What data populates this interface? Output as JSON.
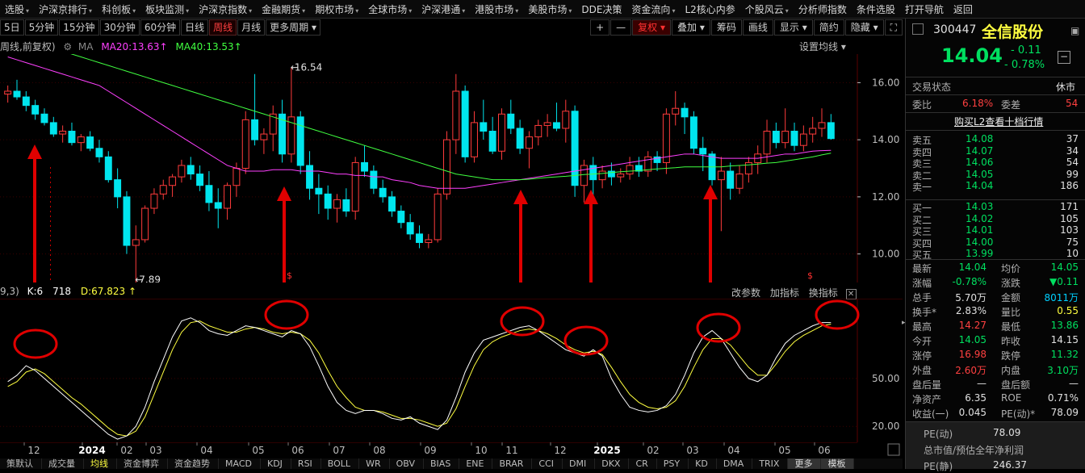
{
  "top_menu": [
    {
      "label": "选股",
      "dd": true
    },
    {
      "label": "沪深京排行",
      "dd": true
    },
    {
      "label": "科创板",
      "dd": true
    },
    {
      "label": "板块监测",
      "dd": true
    },
    {
      "label": "沪深京指数",
      "dd": true
    },
    {
      "label": "金融期货",
      "dd": true
    },
    {
      "label": "期权市场",
      "dd": true
    },
    {
      "label": "全球市场",
      "dd": true
    },
    {
      "label": "沪深港通",
      "dd": true
    },
    {
      "label": "港股市场",
      "dd": true
    },
    {
      "label": "美股市场",
      "dd": true
    },
    {
      "label": "DDE决策",
      "dd": false
    },
    {
      "label": "资金流向",
      "dd": true
    },
    {
      "label": "L2核心内参",
      "dd": false
    },
    {
      "label": "个股风云",
      "dd": true
    },
    {
      "label": "分析师指数",
      "dd": false
    },
    {
      "label": "条件选股",
      "dd": false
    },
    {
      "label": "打开导航",
      "dd": false
    },
    {
      "label": "返回",
      "dd": false
    }
  ],
  "toolbar": {
    "periods": [
      "5日",
      "5分钟",
      "15分钟",
      "30分钟",
      "60分钟",
      "日线",
      "周线",
      "月线",
      "更多周期 ▾"
    ],
    "active_period": "周线",
    "right_buttons": [
      "+",
      "—",
      "复权 ▾",
      "叠加 ▾",
      "筹码",
      "画线",
      "显示 ▾",
      "简约",
      "隐藏 ▾",
      "⛶"
    ]
  },
  "ma_legend": {
    "mode": "周线,前复权)",
    "ma_label": "MA",
    "ma20": "MA20:13.63",
    "ma40": "MA40:13.53",
    "settings": "设置均线 ▾"
  },
  "chart_data": {
    "type": "candlestick",
    "period": "weekly",
    "ylim": [
      9.0,
      17.0
    ],
    "y_ticks": [
      "16.00",
      "14.00",
      "12.00",
      "10.00"
    ],
    "x_labels": [
      "12",
      "2024",
      "02",
      "03",
      "04",
      "05",
      "06",
      "07",
      "08",
      "09",
      "10",
      "11",
      "12",
      "2025",
      "02",
      "03",
      "04",
      "05",
      "06"
    ],
    "candles": [
      [
        15.6,
        15.9,
        15.3,
        15.7
      ],
      [
        15.7,
        16.1,
        15.4,
        15.5
      ],
      [
        15.5,
        15.7,
        15.0,
        15.2
      ],
      [
        15.2,
        15.4,
        14.7,
        14.9
      ],
      [
        14.9,
        15.1,
        14.5,
        14.6
      ],
      [
        14.6,
        14.8,
        14.1,
        14.2
      ],
      [
        14.2,
        14.5,
        13.9,
        14.3
      ],
      [
        14.3,
        14.6,
        13.8,
        13.9
      ],
      [
        13.9,
        14.2,
        13.6,
        14.1
      ],
      [
        14.1,
        14.3,
        13.6,
        13.7
      ],
      [
        13.7,
        14.0,
        13.2,
        13.4
      ],
      [
        13.4,
        13.6,
        12.5,
        12.6
      ],
      [
        12.6,
        13.0,
        11.6,
        12.0
      ],
      [
        12.0,
        12.2,
        10.0,
        10.3
      ],
      [
        10.3,
        11.0,
        7.89,
        10.5
      ],
      [
        10.5,
        11.7,
        10.4,
        11.6
      ],
      [
        11.6,
        12.3,
        11.4,
        12.1
      ],
      [
        12.1,
        12.6,
        11.9,
        12.4
      ],
      [
        12.4,
        12.8,
        12.0,
        12.7
      ],
      [
        12.7,
        13.3,
        12.5,
        13.1
      ],
      [
        13.1,
        13.4,
        12.6,
        12.8
      ],
      [
        12.8,
        13.1,
        12.2,
        12.4
      ],
      [
        12.4,
        12.9,
        11.5,
        11.8
      ],
      [
        11.8,
        12.3,
        10.9,
        11.6
      ],
      [
        11.6,
        12.5,
        11.2,
        12.4
      ],
      [
        12.4,
        13.2,
        12.0,
        13.0
      ],
      [
        13.0,
        15.0,
        12.8,
        14.7
      ],
      [
        14.7,
        16.3,
        13.8,
        14.0
      ],
      [
        14.0,
        14.4,
        13.5,
        14.2
      ],
      [
        14.2,
        15.2,
        13.6,
        14.9
      ],
      [
        14.9,
        15.4,
        13.2,
        13.5
      ],
      [
        13.5,
        16.54,
        13.2,
        14.8
      ],
      [
        14.8,
        15.0,
        12.8,
        13.1
      ],
      [
        13.1,
        13.6,
        11.9,
        12.3
      ],
      [
        12.3,
        12.8,
        11.4,
        12.1
      ],
      [
        12.1,
        12.4,
        11.2,
        11.6
      ],
      [
        11.6,
        12.1,
        11.1,
        11.9
      ],
      [
        11.9,
        12.3,
        11.3,
        11.5
      ],
      [
        11.5,
        13.4,
        11.2,
        13.2
      ],
      [
        13.2,
        13.8,
        12.7,
        12.9
      ],
      [
        12.9,
        13.1,
        12.1,
        12.3
      ],
      [
        12.3,
        12.6,
        11.8,
        12.0
      ],
      [
        12.0,
        12.2,
        11.3,
        11.5
      ],
      [
        11.5,
        11.7,
        10.9,
        11.1
      ],
      [
        11.1,
        11.4,
        10.5,
        10.7
      ],
      [
        10.7,
        11.0,
        10.2,
        10.4
      ],
      [
        10.4,
        10.7,
        10.2,
        10.5
      ],
      [
        10.5,
        12.3,
        10.4,
        12.1
      ],
      [
        12.1,
        14.3,
        11.9,
        14.0
      ],
      [
        14.0,
        16.3,
        13.5,
        15.7
      ],
      [
        15.7,
        15.9,
        13.2,
        13.4
      ],
      [
        13.4,
        15.0,
        13.2,
        14.6
      ],
      [
        14.6,
        15.4,
        14.0,
        14.3
      ],
      [
        14.3,
        14.8,
        13.5,
        13.6
      ],
      [
        13.6,
        15.1,
        13.3,
        14.9
      ],
      [
        14.9,
        15.4,
        14.2,
        14.4
      ],
      [
        14.4,
        14.7,
        13.5,
        13.7
      ],
      [
        13.7,
        14.3,
        13.0,
        14.1
      ],
      [
        14.1,
        14.7,
        13.8,
        14.5
      ],
      [
        14.5,
        14.9,
        14.1,
        14.6
      ],
      [
        14.6,
        15.3,
        14.3,
        14.4
      ],
      [
        14.4,
        15.4,
        13.9,
        15.0
      ],
      [
        15.0,
        15.2,
        12.0,
        12.4
      ],
      [
        12.4,
        13.3,
        11.8,
        13.1
      ],
      [
        13.1,
        13.4,
        11.8,
        12.6
      ],
      [
        12.6,
        13.1,
        12.3,
        12.9
      ],
      [
        12.9,
        13.2,
        12.4,
        12.7
      ],
      [
        12.7,
        13.0,
        12.5,
        12.8
      ],
      [
        12.8,
        13.4,
        12.6,
        13.1
      ],
      [
        13.1,
        13.4,
        12.7,
        12.9
      ],
      [
        12.9,
        13.6,
        12.7,
        13.4
      ],
      [
        13.4,
        13.6,
        12.9,
        13.2
      ],
      [
        13.2,
        15.1,
        12.8,
        14.9
      ],
      [
        14.9,
        15.7,
        14.5,
        15.1
      ],
      [
        15.1,
        15.3,
        14.2,
        14.8
      ],
      [
        14.8,
        15.0,
        13.5,
        13.7
      ],
      [
        13.7,
        14.1,
        12.9,
        13.5
      ],
      [
        13.5,
        13.6,
        12.4,
        12.6
      ],
      [
        12.6,
        13.4,
        10.8,
        12.9
      ],
      [
        12.9,
        13.2,
        11.9,
        12.3
      ],
      [
        12.3,
        13.1,
        12.1,
        12.8
      ],
      [
        12.8,
        13.4,
        12.5,
        13.2
      ],
      [
        13.2,
        13.8,
        12.8,
        13.5
      ],
      [
        13.5,
        14.7,
        13.2,
        14.3
      ],
      [
        14.3,
        14.6,
        13.7,
        13.9
      ],
      [
        13.9,
        15.1,
        13.7,
        14.3
      ],
      [
        14.3,
        14.6,
        13.6,
        13.8
      ],
      [
        13.8,
        14.5,
        13.6,
        14.2
      ],
      [
        14.2,
        14.8,
        13.9,
        14.4
      ],
      [
        14.4,
        15.1,
        14.1,
        14.6
      ],
      [
        14.6,
        14.9,
        14.0,
        14.04
      ]
    ],
    "ma20": [
      16.9,
      16.8,
      16.7,
      16.6,
      16.5,
      16.4,
      16.3,
      16.2,
      16.1,
      16.0,
      15.9,
      15.7,
      15.5,
      15.3,
      15.1,
      14.9,
      14.7,
      14.5,
      14.3,
      14.1,
      13.9,
      13.7,
      13.5,
      13.3,
      13.1,
      13.0,
      12.9,
      12.9,
      12.9,
      12.95,
      12.95,
      12.95,
      12.9,
      12.9,
      12.9,
      12.85,
      12.8,
      12.8,
      12.75,
      12.75,
      12.7,
      12.7,
      12.6,
      12.55,
      12.5,
      12.4,
      12.35,
      12.3,
      12.3,
      12.3,
      12.3,
      12.35,
      12.4,
      12.45,
      12.5,
      12.55,
      12.6,
      12.65,
      12.7,
      12.75,
      12.8,
      12.85,
      12.9,
      12.95,
      13.0,
      13.05,
      13.1,
      13.15,
      13.2,
      13.25,
      13.3,
      13.35,
      13.4,
      13.45,
      13.5,
      13.5,
      13.45,
      13.4,
      13.35,
      13.35,
      13.35,
      13.35,
      13.35,
      13.4,
      13.45,
      13.5,
      13.5,
      13.55,
      13.6,
      13.62,
      13.63
    ],
    "ma40": [
      17.5,
      17.45,
      17.4,
      17.35,
      17.3,
      17.2,
      17.1,
      17.0,
      16.9,
      16.8,
      16.7,
      16.6,
      16.5,
      16.4,
      16.3,
      16.2,
      16.1,
      16.0,
      15.9,
      15.8,
      15.7,
      15.6,
      15.5,
      15.4,
      15.3,
      15.2,
      15.1,
      15.0,
      14.9,
      14.8,
      14.7,
      14.6,
      14.5,
      14.4,
      14.3,
      14.2,
      14.1,
      14.0,
      13.9,
      13.8,
      13.7,
      13.6,
      13.5,
      13.4,
      13.3,
      13.2,
      13.1,
      13.0,
      12.9,
      12.8,
      12.75,
      12.7,
      12.65,
      12.6,
      12.6,
      12.6,
      12.6,
      12.62,
      12.65,
      12.68,
      12.7,
      12.72,
      12.75,
      12.78,
      12.8,
      12.82,
      12.85,
      12.88,
      12.9,
      12.92,
      12.95,
      12.98,
      13.0,
      13.02,
      13.05,
      13.05,
      13.05,
      13.05,
      13.05,
      13.08,
      13.1,
      13.12,
      13.15,
      13.18,
      13.2,
      13.25,
      13.3,
      13.35,
      13.4,
      13.47,
      13.53
    ],
    "annotations": [
      {
        "text": "16.54",
        "candle": 31,
        "price": 16.54
      },
      {
        "text": "7.89",
        "candle": 14,
        "price": 7.89
      }
    ]
  },
  "kdj": {
    "legend_prefix": "9,3)",
    "k_label": "K:6",
    "k_tail": "718",
    "d_label": "D:67.823",
    "arrow": "↑",
    "controls": [
      "改参数",
      "加指标",
      "换指标"
    ],
    "ylim": [
      10,
      100
    ],
    "y_ticks": [
      "50.00",
      "20.00"
    ],
    "k": [
      48,
      52,
      58,
      55,
      50,
      45,
      40,
      35,
      30,
      25,
      20,
      15,
      12,
      14,
      20,
      32,
      48,
      62,
      76,
      86,
      88,
      85,
      80,
      78,
      77,
      80,
      83,
      82,
      80,
      78,
      76,
      80,
      78,
      70,
      58,
      45,
      35,
      30,
      28,
      30,
      30,
      28,
      25,
      24,
      26,
      22,
      20,
      18,
      24,
      38,
      54,
      66,
      74,
      76,
      78,
      80,
      82,
      83,
      80,
      76,
      72,
      68,
      66,
      64,
      68,
      64,
      50,
      40,
      32,
      30,
      29,
      30,
      33,
      40,
      52,
      66,
      76,
      80,
      75,
      66,
      57,
      50,
      48,
      52,
      63,
      72,
      77,
      80,
      83,
      85,
      85
    ],
    "d": [
      45,
      48,
      54,
      56,
      53,
      48,
      43,
      38,
      34,
      29,
      24,
      19,
      15,
      14,
      17,
      26,
      40,
      54,
      68,
      79,
      85,
      86,
      83,
      81,
      79,
      79,
      81,
      82,
      81,
      79,
      78,
      79,
      78,
      74,
      66,
      55,
      45,
      38,
      32,
      30,
      30,
      29,
      27,
      25,
      25,
      24,
      22,
      20,
      22,
      31,
      45,
      58,
      68,
      73,
      76,
      78,
      80,
      81,
      80,
      78,
      75,
      71,
      68,
      66,
      67,
      65,
      57,
      48,
      40,
      35,
      32,
      31,
      32,
      36,
      45,
      57,
      68,
      75,
      75,
      71,
      64,
      57,
      52,
      52,
      59,
      67,
      73,
      77,
      80,
      83,
      84
    ]
  },
  "bottom_tabs": [
    "策默认",
    "成交量",
    "均线",
    "资金博弈",
    "资金趋势",
    "MACD",
    "KDJ",
    "RSI",
    "BOLL",
    "WR",
    "OBV",
    "BIAS",
    "ENE",
    "BRAR",
    "CCI",
    "DMI",
    "DKX",
    "CR",
    "PSY",
    "KD",
    "DMA",
    "TRIX",
    "更多",
    "模板"
  ],
  "active_tab": "均线",
  "quote": {
    "code": "300447",
    "name": "全信股份",
    "price": "14.04",
    "change": "- 0.11",
    "change_pct": "- 0.78%",
    "status_label": "交易状态",
    "status_value": "休市",
    "weibi_label": "委比",
    "weibi_value": "6.18%",
    "weicha_label": "委差",
    "weicha_value": "54",
    "l2_link": "购买L2查看十档行情",
    "asks": [
      {
        "label": "卖五",
        "price": "14.08",
        "vol": "37"
      },
      {
        "label": "卖四",
        "price": "14.07",
        "vol": "34"
      },
      {
        "label": "卖三",
        "price": "14.06",
        "vol": "54"
      },
      {
        "label": "卖二",
        "price": "14.05",
        "vol": "99"
      },
      {
        "label": "卖一",
        "price": "14.04",
        "vol": "186"
      }
    ],
    "bids": [
      {
        "label": "买一",
        "price": "14.03",
        "vol": "171"
      },
      {
        "label": "买二",
        "price": "14.02",
        "vol": "105"
      },
      {
        "label": "买三",
        "price": "14.01",
        "vol": "103"
      },
      {
        "label": "买四",
        "price": "14.00",
        "vol": "75"
      },
      {
        "label": "买五",
        "price": "13.99",
        "vol": "10"
      }
    ],
    "stats": [
      {
        "l1": "最新",
        "v1": "14.04",
        "c1": "gr",
        "l2": "均价",
        "v2": "14.05",
        "c2": "gr"
      },
      {
        "l1": "涨幅",
        "v1": "-0.78%",
        "c1": "gr",
        "l2": "涨跌",
        "v2": "▼0.11",
        "c2": "gr"
      },
      {
        "l1": "总手",
        "v1": "5.70万",
        "c1": "wh",
        "l2": "金额",
        "v2": "8011万",
        "c2": "cy"
      },
      {
        "l1": "换手*",
        "v1": "2.83%",
        "c1": "wh",
        "l2": "量比",
        "v2": "0.55",
        "c2": "yl"
      },
      {
        "l1": "最高",
        "v1": "14.27",
        "c1": "rd",
        "l2": "最低",
        "v2": "13.86",
        "c2": "gr"
      },
      {
        "l1": "今开",
        "v1": "14.05",
        "c1": "gr",
        "l2": "昨收",
        "v2": "14.15",
        "c2": "wh"
      },
      {
        "l1": "涨停",
        "v1": "16.98",
        "c1": "rd",
        "l2": "跌停",
        "v2": "11.32",
        "c2": "gr"
      },
      {
        "l1": "外盘",
        "v1": "2.60万",
        "c1": "rd",
        "l2": "内盘",
        "v2": "3.10万",
        "c2": "gr"
      },
      {
        "l1": "盘后量",
        "v1": "—",
        "c1": "wh",
        "l2": "盘后额",
        "v2": "—",
        "c2": "wh"
      },
      {
        "l1": "净资产",
        "v1": "6.35",
        "c1": "wh",
        "l2": "ROE",
        "v2": "0.71%",
        "c2": "wh"
      },
      {
        "l1": "收益(一)",
        "v1": "0.045",
        "c1": "wh",
        "l2": "PE(动)*",
        "v2": "78.09",
        "c2": "wh"
      }
    ],
    "pe_dyn_label": "PE(动)",
    "pe_dyn_value": "78.09",
    "mktcap_label": "总市值/预估全年净利润",
    "pe_static_label": "PE(静)",
    "pe_static_value": "246.37"
  },
  "colors": {
    "up": "#ff3b3b",
    "down": "#00e5ee",
    "ma20": "#ff40ff",
    "ma40": "#40ff40",
    "k": "#ffffff",
    "d": "#ffff40",
    "annotation": "#e00000"
  }
}
